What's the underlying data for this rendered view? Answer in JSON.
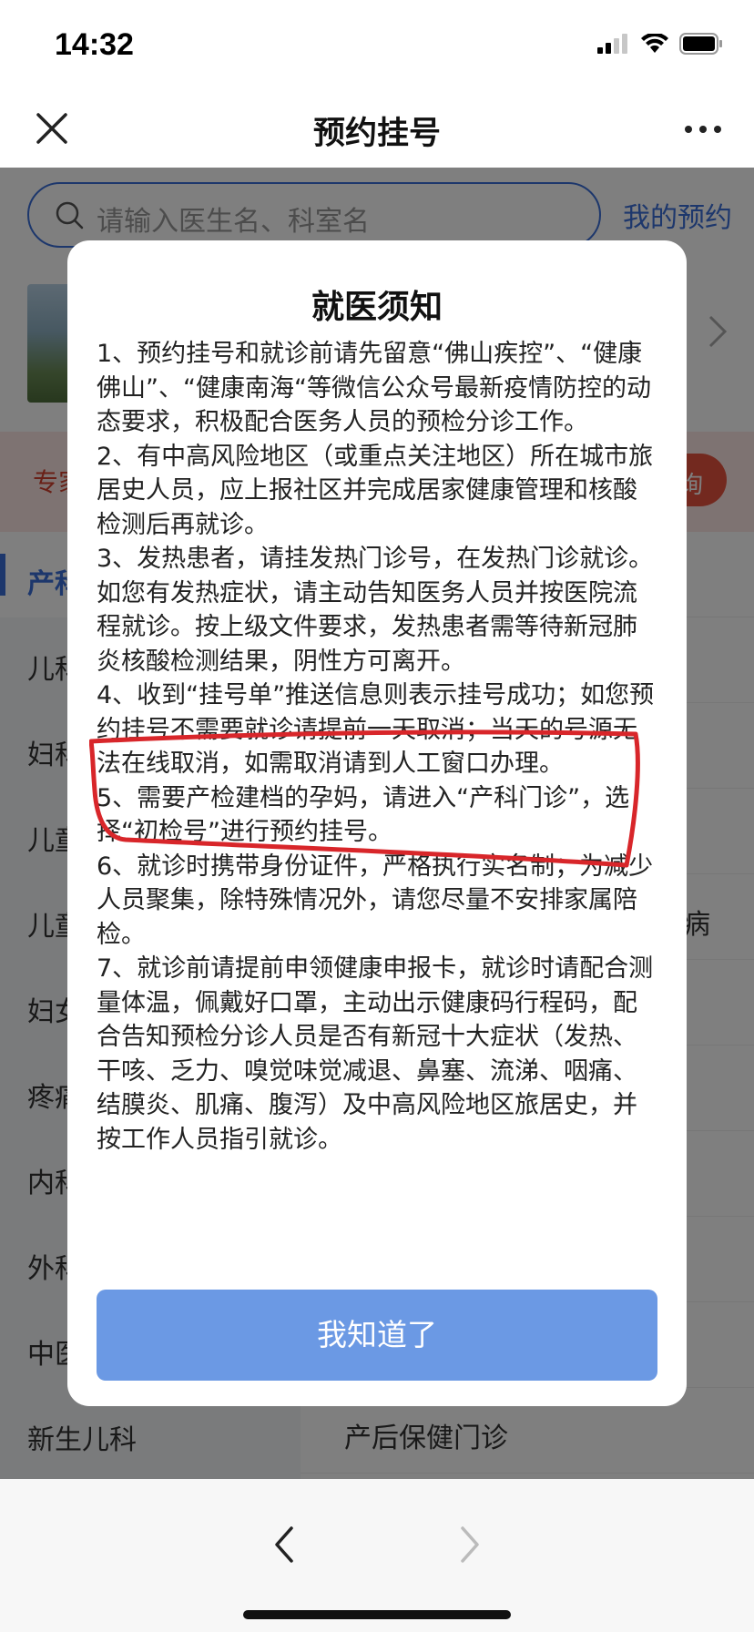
{
  "status_bar": {
    "time": "14:32"
  },
  "nav": {
    "title": "预约挂号",
    "close_icon": "close-icon",
    "more_icon": "more-icon"
  },
  "search": {
    "placeholder": "请输入医生名、科室名",
    "my_appointments": "我的预约"
  },
  "banner": {
    "text": "专家",
    "button": "询"
  },
  "departments": [
    "产科",
    "儿科",
    "妇科",
    "儿童",
    "儿童",
    "妇女",
    "疼痛",
    "内科",
    "外科",
    "中医",
    "新生儿科"
  ],
  "clinics": [
    "",
    "",
    "",
    "",
    "病",
    "",
    "",
    "",
    "",
    "",
    "产后保健门诊"
  ],
  "notice": {
    "title": "就医须知",
    "items": [
      "1、预约挂号和就诊前请先留意“佛山疾控”、“健康佛山”、“健康南海“等微信公众号最新疫情防控的动态要求，积极配合医务人员的预检分诊工作。",
      "2、有中高风险地区（或重点关注地区）所在城市旅居史人员，应上报社区并完成居家健康管理和核酸检测后再就诊。",
      "3、发热患者，请挂发热门诊号，在发热门诊就诊。如您有发热症状，请主动告知医务人员并按医院流程就诊。按上级文件要求，发热患者需等待新冠肺炎核酸检测结果，阴性方可离开。",
      "4、收到“挂号单”推送信息则表示挂号成功；如您预约挂号不需要就诊请提前一天取消；当天的号源无法在线取消，如需取消请到人工窗口办理。",
      "5、需要产检建档的孕妈，请进入“产科门诊”，选择“初检号”进行预约挂号。",
      "6、就诊时携带身份证件，严格执行实名制；为减少人员聚集，除特殊情况外，请您尽量不安排家属陪检。",
      "7、就诊前请提前申领健康申报卡，就诊时请配合测量体温，佩戴好口罩，主动出示健康码行程码，配合告知预检分诊人员是否有新冠十大症状（发热、干咳、乏力、嗅觉味觉减退、鼻塞、流涕、咽痛、结膜炎、肌痛、腹泻）及中高风险地区旅居史，并按工作人员指引就诊。"
    ],
    "confirm_label": "我知道了"
  },
  "colors": {
    "accent": "#3b6fd9",
    "button": "#6b99e4",
    "annotation": "#d8262a",
    "banner_red": "#e6533f"
  }
}
